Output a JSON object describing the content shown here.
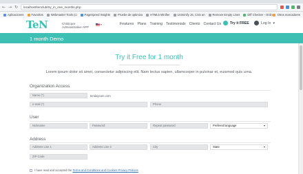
{
  "browser": {
    "url": "localhost/tenclub/try_in_one_months.php",
    "bookmarks": [
      "Aplicaciones",
      "Favoritos",
      "Webmaster Tools (ci",
      "PageSpeed Insights",
      "Pruebe de optimiza",
      "HTML5 Minifier",
      "Uniminify JS, CSS an",
      "Remove Empty Lines",
      "Diff Checker - Onlin"
    ],
    "other_bookmarks": "Otros marcadores"
  },
  "header": {
    "logo": "TeN",
    "tagline": [
      "Childcare",
      "Administrative APP"
    ],
    "nav": [
      "Features",
      "Plans",
      "Training",
      "Testimonials",
      "Clients",
      "Contact Us"
    ],
    "try_free": "Try it FREE",
    "login": "Log In"
  },
  "banner": {
    "title": "1 month Demo"
  },
  "main": {
    "heading": "Try it Free for 1 month",
    "lead": "Lorem ipsum dolor sit amet, consectetur adipiscing elit. Nam lectus sapien, ullamcorper in pulvinar et, euismod quis urna."
  },
  "organization": {
    "title": "Organization Access",
    "name_placeholder": "Name (*)",
    "domain_suffix": "tendaycare.com",
    "email_placeholder": "e-mail (*)",
    "phone_placeholder": "Phone"
  },
  "user": {
    "title": "User",
    "nickname_placeholder": "Nickname",
    "password_placeholder": "Password",
    "repeat_password_placeholder": "Repeat password",
    "language_selected": "Prefered language"
  },
  "address": {
    "title": "Address",
    "line1_placeholder": "Address Line 1",
    "line2_placeholder": "Address Line 2",
    "city_placeholder": "City",
    "state_selected": "State",
    "zip_placeholder": "ZIP Code"
  },
  "terms": {
    "prefix": "I have read and accepted the ",
    "link": "Terms and Conditions and Cookies Privacy Policies"
  }
}
